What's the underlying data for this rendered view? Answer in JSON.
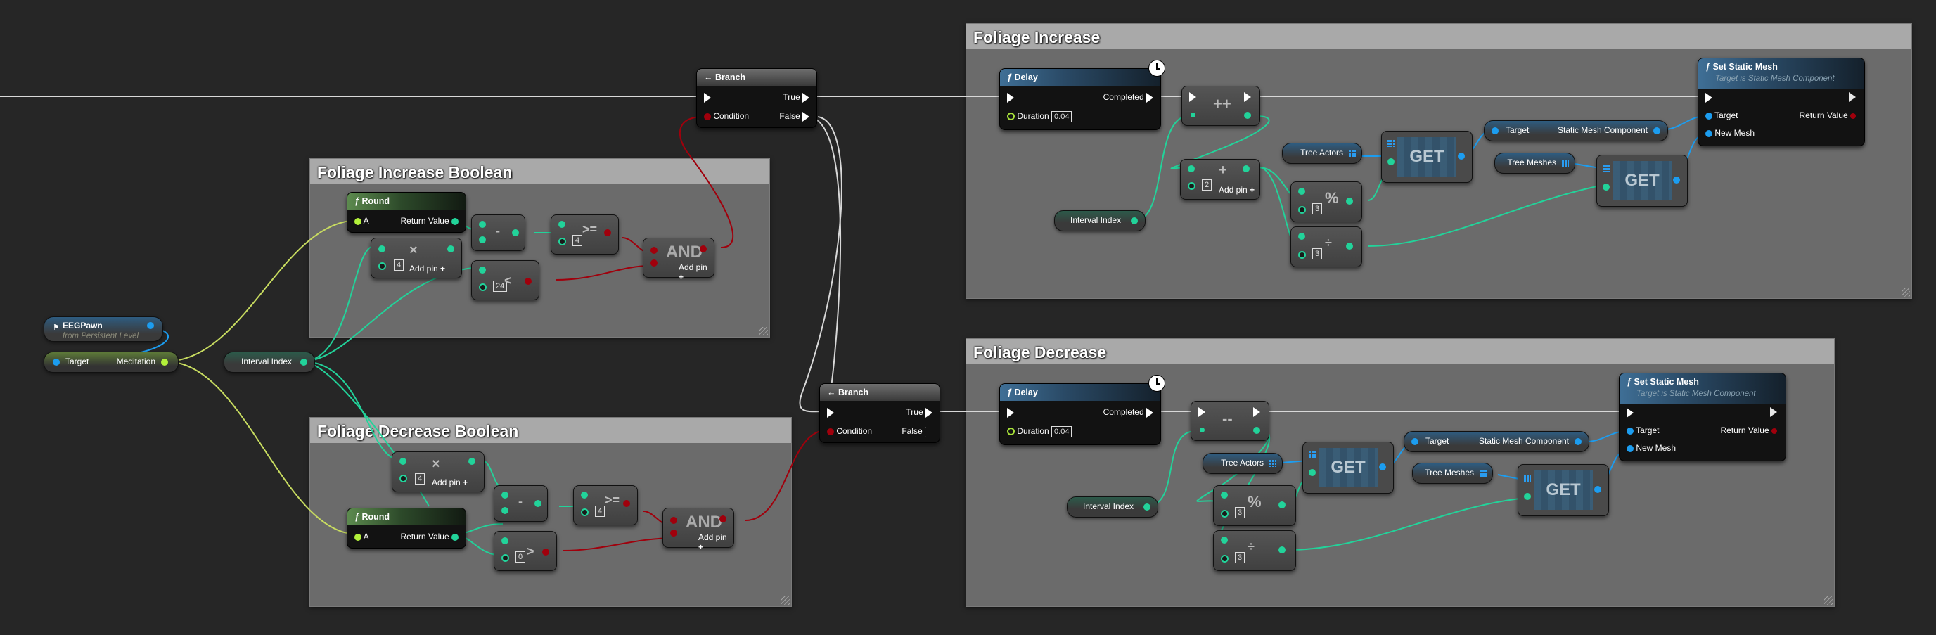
{
  "colors": {
    "background": "#262626",
    "comment_body": "#6b6b6b",
    "comment_title": "#a9a9a9",
    "exec_wire": "#e0e0e0",
    "int_pin": "#22d39a",
    "float_pin": "#b2f03a",
    "object_pin": "#1c9df0",
    "bool_pin": "#a0000c"
  },
  "comments": {
    "foliage_increase_boolean": "Foliage Increase Boolean",
    "foliage_decrease_boolean": "Foliage Decrease Boolean",
    "foliage_increase": "Foliage Increase",
    "foliage_decrease": "Foliage Decrease"
  },
  "eeg_pawn": {
    "title": "EEGPawn",
    "subtitle": "from Persistent Level",
    "icon": "actor-icon"
  },
  "get_meditation": {
    "input": "Target",
    "output": "Meditation"
  },
  "interval_index_var": "Interval Index",
  "branch": {
    "title": "Branch",
    "true": "True",
    "false": "False",
    "condition": "Condition"
  },
  "round": {
    "title": "Round",
    "input": "A",
    "output": "Return Value"
  },
  "ops": {
    "multiply": "×",
    "subtract": "-",
    "gte": ">=",
    "lt": "<",
    "gt": ">",
    "and": "AND",
    "add": "+",
    "modulo": "%",
    "divide": "÷",
    "increment": "++",
    "decrement": "--",
    "add_pin": "Add pin"
  },
  "increase_boolean": {
    "multiply_const": "4",
    "gte_const": "4",
    "lt_const": "24"
  },
  "decrease_boolean": {
    "multiply_const": "4",
    "gte_const": "4",
    "gt_const": "0"
  },
  "delay": {
    "title": "Delay",
    "completed": "Completed",
    "duration_label": "Duration",
    "duration_increase": "0.04",
    "duration_decrease": "0.04"
  },
  "foliage_increase_nodes": {
    "add_const": "2",
    "modulo_const": "3",
    "divide_const": "3"
  },
  "foliage_decrease_nodes": {
    "modulo_const": "3",
    "divide_const": "3"
  },
  "vars": {
    "tree_actors": "Tree Actors",
    "tree_meshes": "Tree Meshes",
    "get": "GET"
  },
  "get_component": {
    "input": "Target",
    "output": "Static Mesh Component"
  },
  "set_static_mesh": {
    "title": "Set Static Mesh",
    "subtitle": "Target is Static Mesh Component",
    "target": "Target",
    "new_mesh": "New Mesh",
    "return_value": "Return Value"
  }
}
